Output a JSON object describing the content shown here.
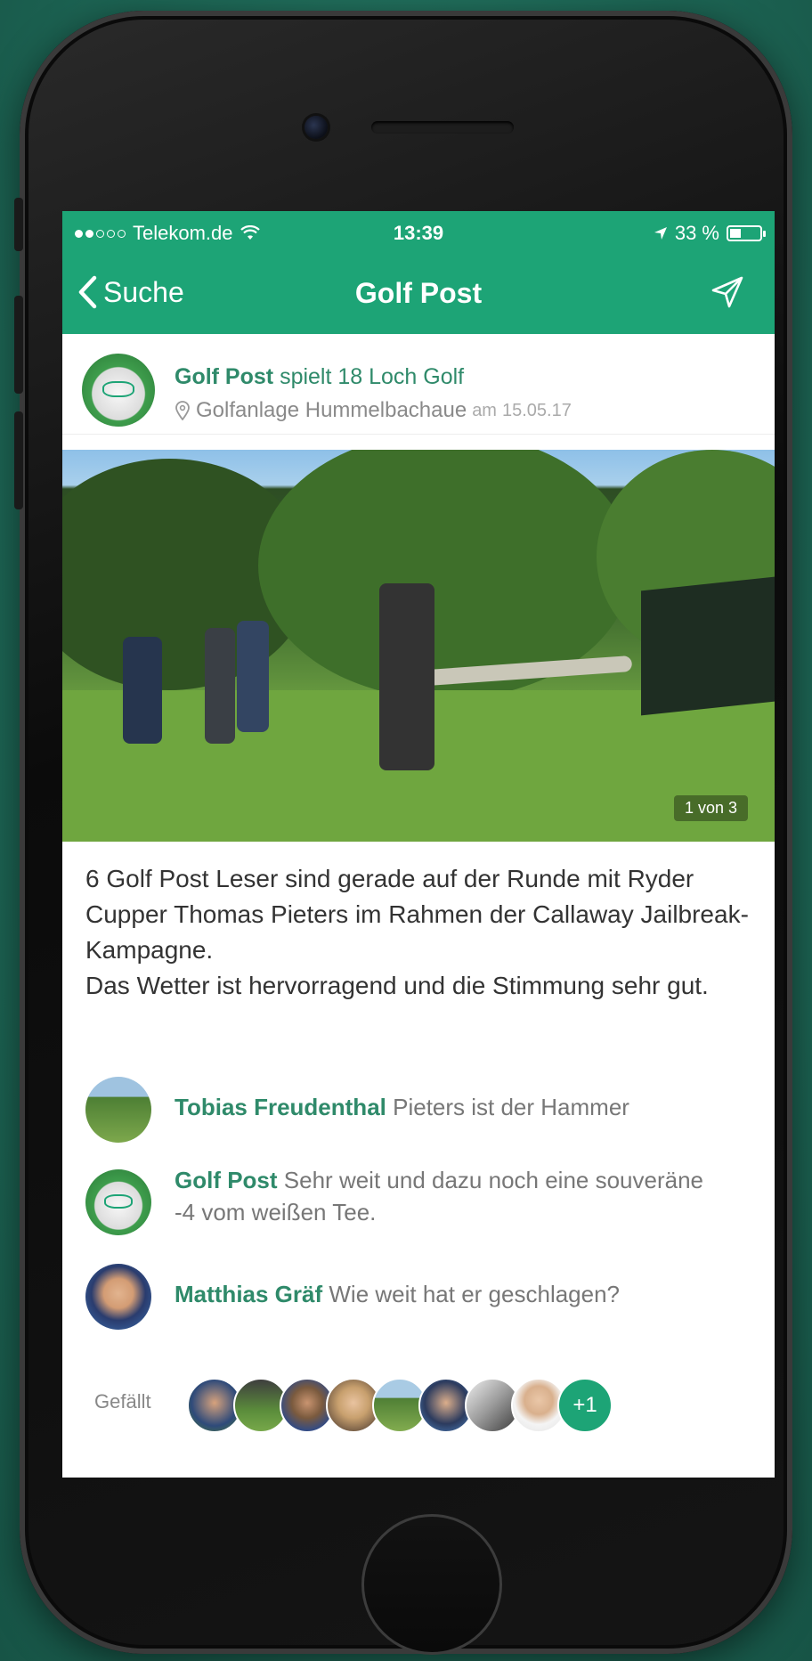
{
  "status_bar": {
    "carrier": "Telekom.de",
    "time": "13:39",
    "battery": "33 %",
    "signal_bars_filled": 2,
    "signal_bars_total": 5
  },
  "nav": {
    "back_label": "Suche",
    "title": "Golf Post"
  },
  "post": {
    "author": "Golf Post",
    "action": "spielt 18 Loch Golf",
    "location": "Golfanlage Hummelbachaue",
    "date_prefix": "am",
    "date": "15.05.17",
    "photo_counter": "1 von 3",
    "caption_line1": "6 Golf Post Leser sind gerade auf der Runde mit Ryder Cupper Thomas Pieters im Rahmen der Callaway Jailbreak-Kampagne.",
    "caption_line2": "Das Wetter ist hervorragend und die Stimmung sehr gut."
  },
  "comments": [
    {
      "name": "Tobias Freudenthal",
      "text": "Pieters ist der Hammer"
    },
    {
      "name": "Golf Post",
      "text": "Sehr weit und dazu noch eine souveräne -4 vom weißen Tee."
    },
    {
      "name": "Matthias Gräf",
      "text": "Wie weit hat er geschlagen?"
    }
  ],
  "likes": {
    "label": "Gefällt",
    "more": "+1"
  },
  "colors": {
    "brand_green": "#1da476",
    "name_green": "#2f8a6a"
  },
  "icons": [
    "wifi-icon",
    "location-arrow-icon",
    "battery-icon",
    "chevron-left-icon",
    "send-icon",
    "map-pin-icon"
  ]
}
